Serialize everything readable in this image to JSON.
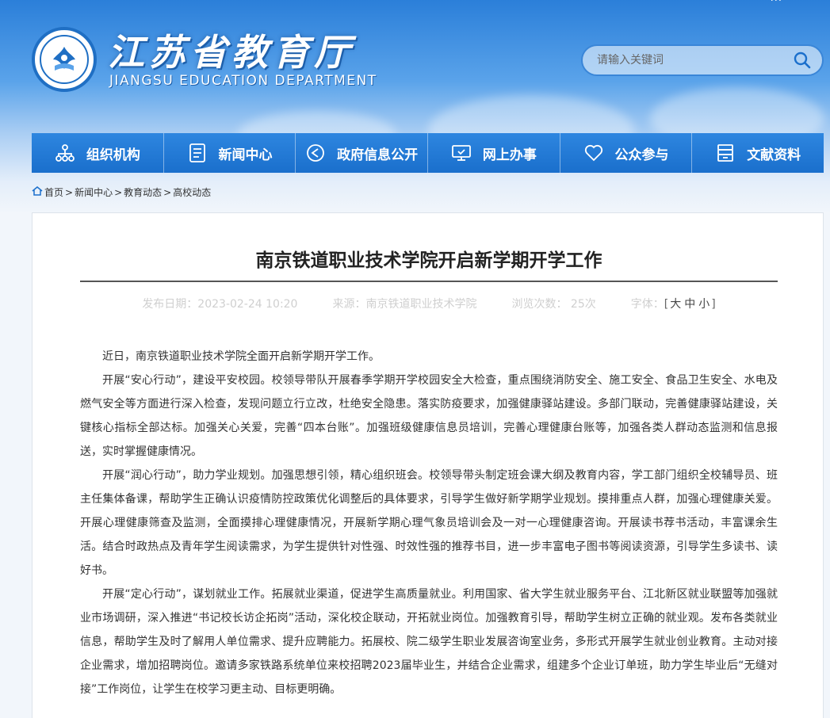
{
  "header": {
    "title": "江苏省教育厅",
    "subtitle": "JIANGSU EDUCATION DEPARTMENT",
    "toplinks": "···"
  },
  "search": {
    "placeholder": "请输入关键词",
    "icon": "search-icon"
  },
  "nav": [
    {
      "label": "组织机构",
      "icon": "org-chart-icon"
    },
    {
      "label": "新闻中心",
      "icon": "document-icon"
    },
    {
      "label": "政府信息公开",
      "icon": "send-icon"
    },
    {
      "label": "网上办事",
      "icon": "monitor-icon"
    },
    {
      "label": "公众参与",
      "icon": "heart-icon"
    },
    {
      "label": "文献资料",
      "icon": "archive-icon"
    }
  ],
  "breadcrumb": {
    "items": [
      "首页",
      "新闻中心",
      "教育动态",
      "高校动态"
    ],
    "separator": ">"
  },
  "article": {
    "title": "南京铁道职业技术学院开启新学期开学工作",
    "date": "发布日期：2023-02-24 10:20",
    "source": "来源：南京铁道职业技术学院",
    "views": "浏览次数： 25次",
    "font_label": "字体：",
    "font_large": "大",
    "font_medium": "中",
    "font_small": "小",
    "paragraphs": [
      "近日，南京铁道职业技术学院全面开启新学期开学工作。",
      "开展“安心行动”，建设平安校园。校领导带队开展春季学期开学校园安全大检查，重点围绕消防安全、施工安全、食品卫生安全、水电及燃气安全等方面进行深入检查，发现问题立行立改，杜绝安全隐患。落实防疫要求，加强健康驿站建设。多部门联动，完善健康驿站建设，关键核心指标全部达标。加强关心关爱，完善“四本台账”。加强班级健康信息员培训，完善心理健康台账等，加强各类人群动态监测和信息报送，实时掌握健康情况。",
      "开展“润心行动”，助力学业规划。加强思想引领，精心组织班会。校领导带头制定班会课大纲及教育内容，学工部门组织全校辅导员、班主任集体备课，帮助学生正确认识疫情防控政策优化调整后的具体要求，引导学生做好新学期学业规划。摸排重点人群，加强心理健康关爱。开展心理健康筛查及监测，全面摸排心理健康情况，开展新学期心理气象员培训会及一对一心理健康咨询。开展读书荐书活动，丰富课余生活。结合时政热点及青年学生阅读需求，为学生提供针对性强、时效性强的推荐书目，进一步丰富电子图书等阅读资源，引导学生多读书、读好书。",
      "开展“定心行动”，谋划就业工作。拓展就业渠道，促进学生高质量就业。利用国家、省大学生就业服务平台、江北新区就业联盟等加强就业市场调研，深入推进“书记校长访企拓岗”活动，深化校企联动，开拓就业岗位。加强教育引导，帮助学生树立正确的就业观。发布各类就业信息，帮助学生及时了解用人单位需求、提升应聘能力。拓展校、院二级学生职业发展咨询室业务，多形式开展学生就业创业教育。主动对接企业需求，增加招聘岗位。邀请多家铁路系统单位来校招聘2023届毕业生，并结合企业需求，组建多个企业订单班，助力学生毕业后“无缝对接”工作岗位，让学生在校学习更主动、目标更明确。"
    ]
  },
  "colors": {
    "nav_bg": "#1a6fcc",
    "banner_top": "#2b7fd9",
    "title_text": "#ffffff",
    "meta_text": "#cfcfcf"
  }
}
